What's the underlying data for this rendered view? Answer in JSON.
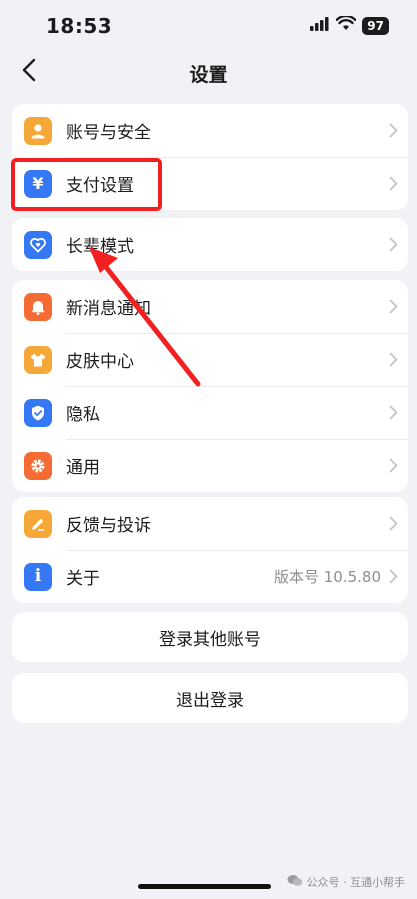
{
  "status_bar": {
    "time": "18:53",
    "battery": "97",
    "icons": [
      "signal-icon",
      "wifi-icon",
      "battery-icon"
    ]
  },
  "nav": {
    "title": "设置",
    "back_icon": "chevron-left-icon"
  },
  "groups": [
    {
      "items": [
        {
          "label": "账号与安全",
          "icon": "person-icon",
          "color": "#f5a738"
        },
        {
          "label": "支付设置",
          "icon": "yen-icon",
          "color": "#3478f6"
        }
      ]
    },
    {
      "items": [
        {
          "label": "长辈模式",
          "icon": "heart-icon",
          "color": "#3478f6"
        }
      ]
    },
    {
      "items": [
        {
          "label": "新消息通知",
          "icon": "bell-icon",
          "color": "#f46b33"
        },
        {
          "label": "皮肤中心",
          "icon": "shirt-icon",
          "color": "#f5a738"
        },
        {
          "label": "隐私",
          "icon": "shield-icon",
          "color": "#3478f6"
        },
        {
          "label": "通用",
          "icon": "gear-icon",
          "color": "#f46b33"
        }
      ]
    },
    {
      "items": [
        {
          "label": "反馈与投诉",
          "icon": "pencil-icon",
          "color": "#f5a738"
        },
        {
          "label": "关于",
          "icon": "info-icon",
          "color": "#3478f6",
          "value": "版本号 10.5.80"
        }
      ]
    }
  ],
  "buttons": {
    "switch_account": "登录其他账号",
    "logout": "退出登录"
  },
  "annotation": {
    "highlight_color": "#f22020"
  },
  "watermark": {
    "text": "公众号 · 互通小帮手"
  }
}
